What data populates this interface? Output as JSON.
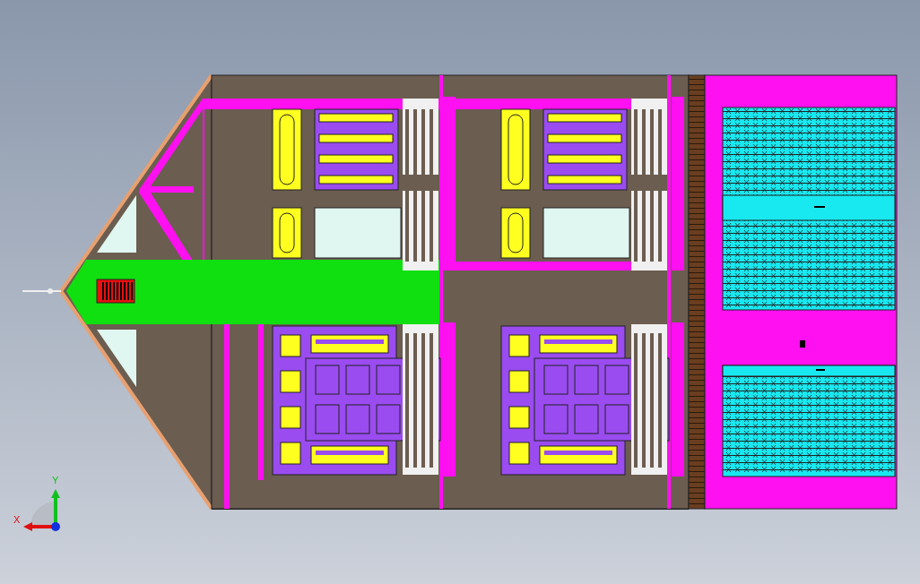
{
  "viewport": {
    "axis_triad": {
      "x_label": "X",
      "y_label": "Y"
    }
  }
}
